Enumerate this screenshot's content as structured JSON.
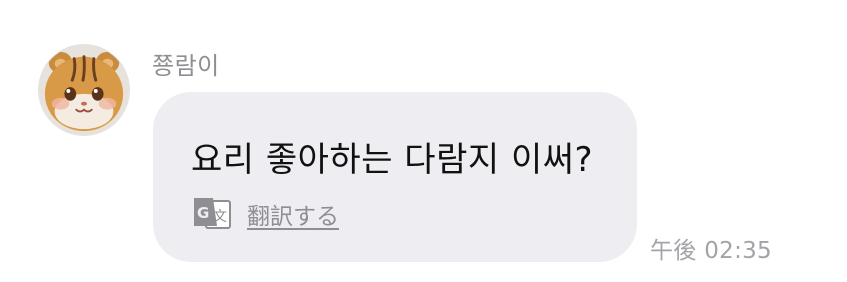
{
  "chat": {
    "sender": {
      "name": "쭁람이",
      "avatar_icon": "hamster-avatar-icon"
    },
    "message": {
      "text": "요리 좋아하는 다람지 이써?",
      "translate_label": "翻訳する",
      "translate_icon": "translate-icon",
      "timestamp": "午後 02:35"
    }
  },
  "colors": {
    "bubble_bg": "#eeeef2",
    "secondary_text": "#8e8e93",
    "message_text": "#111111"
  }
}
